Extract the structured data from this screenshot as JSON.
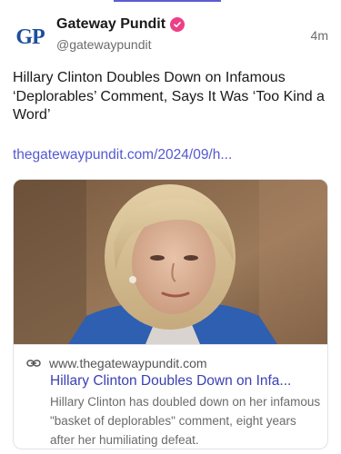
{
  "post": {
    "author": {
      "display_name": "Gateway Pundit",
      "handle": "@gatewaypundit",
      "avatar_initials": "GP",
      "verified": true
    },
    "timestamp": "4m",
    "text": "Hillary Clinton Doubles Down on Infamous ‘Deplorables’ Comment, Says It Was ‘Too Kind a Word’",
    "link": "thegatewaypundit.com/2024/09/h..."
  },
  "link_card": {
    "image_description_icon": "photo-icon",
    "domain": "www.thegatewaypundit.com",
    "title": "Hillary Clinton Doubles Down on Infa...",
    "description": "Hillary Clinton has doubled down on her infamous \"basket of deplorables\" comment, eight years after her humiliating defeat."
  },
  "colors": {
    "brand_blue": "#1d4e9c",
    "verified_pink": "#ec4186",
    "link_purple": "#5459d1",
    "card_title": "#3b40b5"
  }
}
